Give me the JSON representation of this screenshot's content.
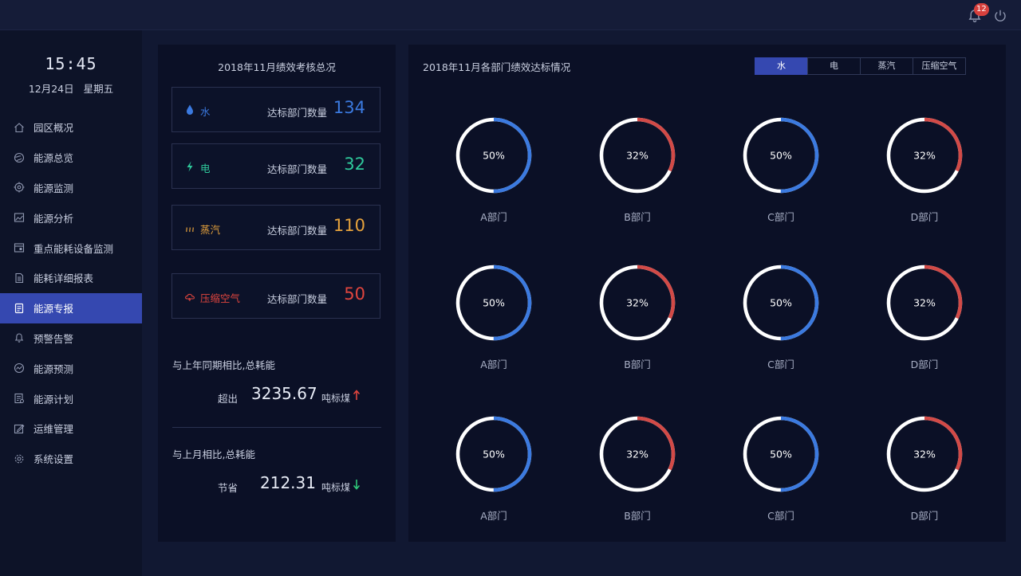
{
  "header": {
    "notification_count": "12"
  },
  "sidebar": {
    "time": "15:45",
    "date": "12月24日",
    "weekday": "星期五",
    "items": [
      {
        "label": "园区概况",
        "icon": "home-icon"
      },
      {
        "label": "能源总览",
        "icon": "globe-icon"
      },
      {
        "label": "能源监测",
        "icon": "target-icon"
      },
      {
        "label": "能源分析",
        "icon": "image-chart-icon"
      },
      {
        "label": "重点能耗设备监测",
        "icon": "device-icon"
      },
      {
        "label": "能耗详细报表",
        "icon": "report-icon"
      },
      {
        "label": "能源专报",
        "icon": "document-icon",
        "active": true
      },
      {
        "label": "预警告警",
        "icon": "bell-icon"
      },
      {
        "label": "能源预测",
        "icon": "trend-icon"
      },
      {
        "label": "能源计划",
        "icon": "plan-icon"
      },
      {
        "label": "运维管理",
        "icon": "edit-icon"
      },
      {
        "label": "系统设置",
        "icon": "gear-icon"
      }
    ]
  },
  "summary": {
    "title": "2018年11月绩效考核总况",
    "cards": [
      {
        "name": "水",
        "label": "达标部门数量",
        "value": "134",
        "color": "#3b7ae0",
        "icon": "water-drop-icon"
      },
      {
        "name": "电",
        "label": "达标部门数量",
        "value": "32",
        "color": "#2fc99b",
        "icon": "lightning-icon"
      },
      {
        "name": "蒸汽",
        "label": "达标部门数量",
        "value": "110",
        "color": "#e6a23c",
        "icon": "steam-icon"
      },
      {
        "name": "压缩空气",
        "label": "达标部门数量",
        "value": "50",
        "color": "#e0453e",
        "icon": "cloud-icon"
      }
    ],
    "yoy": {
      "title": "与上年同期相比,总耗能",
      "word": "超出",
      "value": "3235.67",
      "unit": "吨标煤",
      "trend": "up",
      "trend_color": "#e0453e"
    },
    "mom": {
      "title": "与上月相比,总耗能",
      "word": "节省",
      "value": "212.31",
      "unit": "吨标煤",
      "trend": "down",
      "trend_color": "#2fc97a"
    }
  },
  "departments": {
    "title": "2018年11月各部门绩效达标情况",
    "tabs": [
      {
        "label": "水",
        "active": true
      },
      {
        "label": "电"
      },
      {
        "label": "蒸汽"
      },
      {
        "label": "压缩空气"
      }
    ],
    "colors": {
      "blue": "#3b7ae0",
      "red": "#d24a47",
      "base": "#ffffff"
    },
    "rows": [
      [
        {
          "dept": "A部门",
          "pct": "50%",
          "value": 0.5,
          "color": "blue"
        },
        {
          "dept": "B部门",
          "pct": "32%",
          "value": 0.32,
          "color": "red"
        },
        {
          "dept": "C部门",
          "pct": "50%",
          "value": 0.5,
          "color": "blue"
        },
        {
          "dept": "D部门",
          "pct": "32%",
          "value": 0.32,
          "color": "red"
        }
      ],
      [
        {
          "dept": "A部门",
          "pct": "50%",
          "value": 0.5,
          "color": "blue"
        },
        {
          "dept": "B部门",
          "pct": "32%",
          "value": 0.32,
          "color": "red"
        },
        {
          "dept": "C部门",
          "pct": "50%",
          "value": 0.5,
          "color": "blue"
        },
        {
          "dept": "D部门",
          "pct": "32%",
          "value": 0.32,
          "color": "red"
        }
      ],
      [
        {
          "dept": "A部门",
          "pct": "50%",
          "value": 0.5,
          "color": "blue"
        },
        {
          "dept": "B部门",
          "pct": "32%",
          "value": 0.32,
          "color": "red"
        },
        {
          "dept": "C部门",
          "pct": "50%",
          "value": 0.5,
          "color": "blue"
        },
        {
          "dept": "D部门",
          "pct": "32%",
          "value": 0.32,
          "color": "red"
        }
      ]
    ]
  }
}
